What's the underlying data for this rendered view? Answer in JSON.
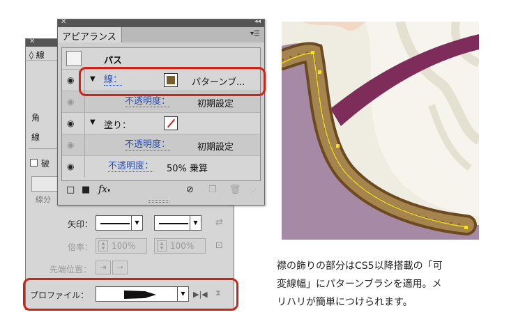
{
  "stroke_panel": {
    "title": "線",
    "peek_labels": [
      "角",
      "線",
      "破",
      "線分"
    ],
    "arrow_label": "矢印：",
    "scale_label": "倍率：",
    "scale_values": [
      "100%",
      "100%"
    ],
    "align_label": "先端位置：",
    "profile_label": "プロファイル："
  },
  "appearance_panel": {
    "tab_label": "アピアランス",
    "object_label": "パス",
    "rows": {
      "stroke_label": "線：",
      "stroke_value": "パターンブ...",
      "stroke_opacity_label": "不透明度：",
      "stroke_opacity_value": "初期設定",
      "fill_label": "塗り：",
      "fill_opacity_label": "不透明度：",
      "fill_opacity_value": "初期設定",
      "object_opacity_label": "不透明度：",
      "object_opacity_value": "50% 乗算"
    },
    "fx_label": "fx"
  },
  "caption_lines": [
    "襟の飾りの部分はCS5以降搭載の「可",
    "変線幅」にパターンブラシを適用。メ",
    "リハリが簡単につけられます。"
  ],
  "colors": {
    "highlight": "#cf2317",
    "link_text": "#2a4fb0",
    "stroke_swatch": "#7a5e2c",
    "collar": "#a6844d",
    "garment": "#a689a4",
    "ribbon": "#7e2d5b"
  },
  "icons": [
    "eye-icon",
    "disclosure-triangle-icon",
    "new-stroke-icon",
    "new-fill-icon",
    "fx-icon",
    "clear-appearance-icon",
    "duplicate-icon",
    "trash-icon",
    "swap-arrows-icon",
    "link-scale-icon",
    "flip-profile-icon"
  ]
}
